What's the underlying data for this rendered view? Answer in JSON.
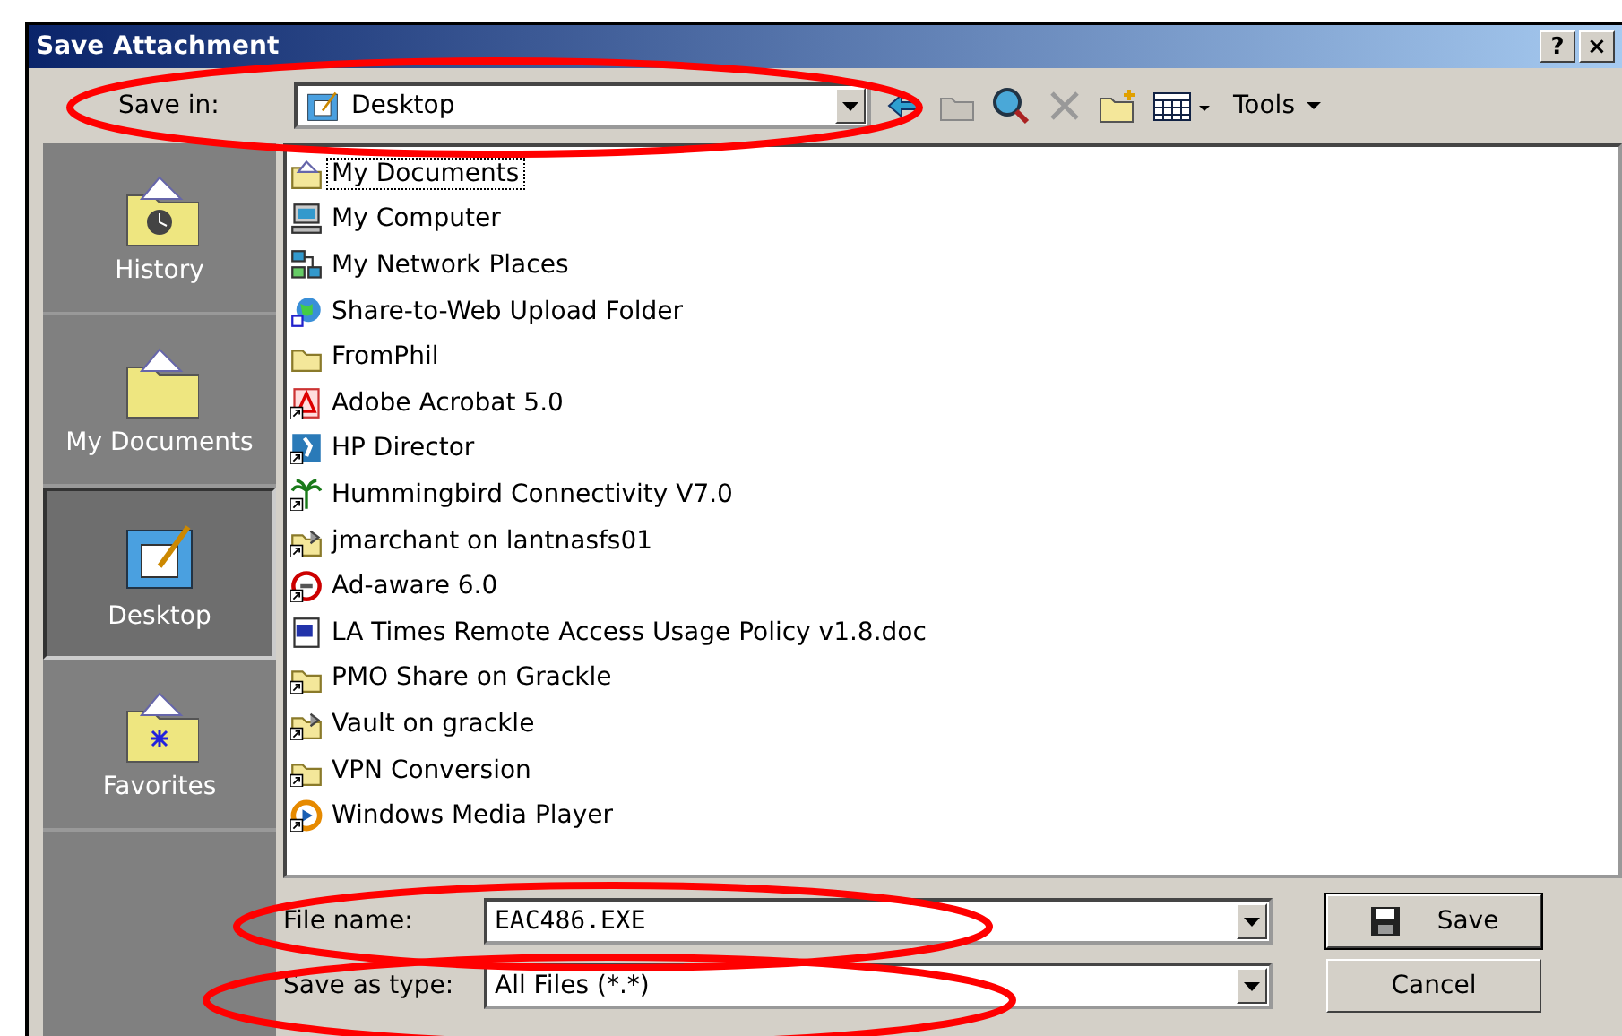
{
  "window": {
    "title": "Save Attachment",
    "help_button": "?",
    "close_button": "×"
  },
  "save_in": {
    "label": "Save in:",
    "value": "Desktop"
  },
  "toolbar": {
    "tools_label": "Tools"
  },
  "places": [
    {
      "label": "History",
      "kind": "history",
      "selected": false
    },
    {
      "label": "My Documents",
      "kind": "documents",
      "selected": false
    },
    {
      "label": "Desktop",
      "kind": "desktop",
      "selected": true
    },
    {
      "label": "Favorites",
      "kind": "favorites",
      "selected": false
    }
  ],
  "files": [
    {
      "name": "My Documents",
      "kind": "documents",
      "shortcut": false,
      "selected": true
    },
    {
      "name": "My Computer",
      "kind": "computer",
      "shortcut": false,
      "selected": false
    },
    {
      "name": "My Network Places",
      "kind": "network",
      "shortcut": false,
      "selected": false
    },
    {
      "name": "Share-to-Web Upload Folder",
      "kind": "globe",
      "shortcut": false,
      "selected": false
    },
    {
      "name": "FromPhil",
      "kind": "folder",
      "shortcut": false,
      "selected": false
    },
    {
      "name": "Adobe Acrobat 5.0",
      "kind": "acrobat",
      "shortcut": true,
      "selected": false
    },
    {
      "name": "HP Director",
      "kind": "app",
      "shortcut": true,
      "selected": false
    },
    {
      "name": "Hummingbird Connectivity V7.0",
      "kind": "palm",
      "shortcut": true,
      "selected": false
    },
    {
      "name": "jmarchant on lantnasfs01",
      "kind": "netfolder",
      "shortcut": true,
      "selected": false
    },
    {
      "name": "Ad-aware 6.0",
      "kind": "adaware",
      "shortcut": true,
      "selected": false
    },
    {
      "name": "LA Times Remote Access Usage Policy v1.8.doc",
      "kind": "word",
      "shortcut": false,
      "selected": false
    },
    {
      "name": "PMO Share on Grackle",
      "kind": "folder",
      "shortcut": true,
      "selected": false
    },
    {
      "name": "Vault on grackle",
      "kind": "netfolder",
      "shortcut": true,
      "selected": false
    },
    {
      "name": "VPN Conversion",
      "kind": "folder",
      "shortcut": true,
      "selected": false
    },
    {
      "name": "Windows Media Player",
      "kind": "media",
      "shortcut": true,
      "selected": false
    }
  ],
  "file_name": {
    "label": "File name:",
    "value": "EAC486.EXE"
  },
  "save_as_type": {
    "label": "Save as type:",
    "value": "All Files (*.*)"
  },
  "buttons": [
    {
      "label": "Save",
      "kind": "save"
    },
    {
      "label": "Cancel",
      "kind": "cancel"
    }
  ]
}
